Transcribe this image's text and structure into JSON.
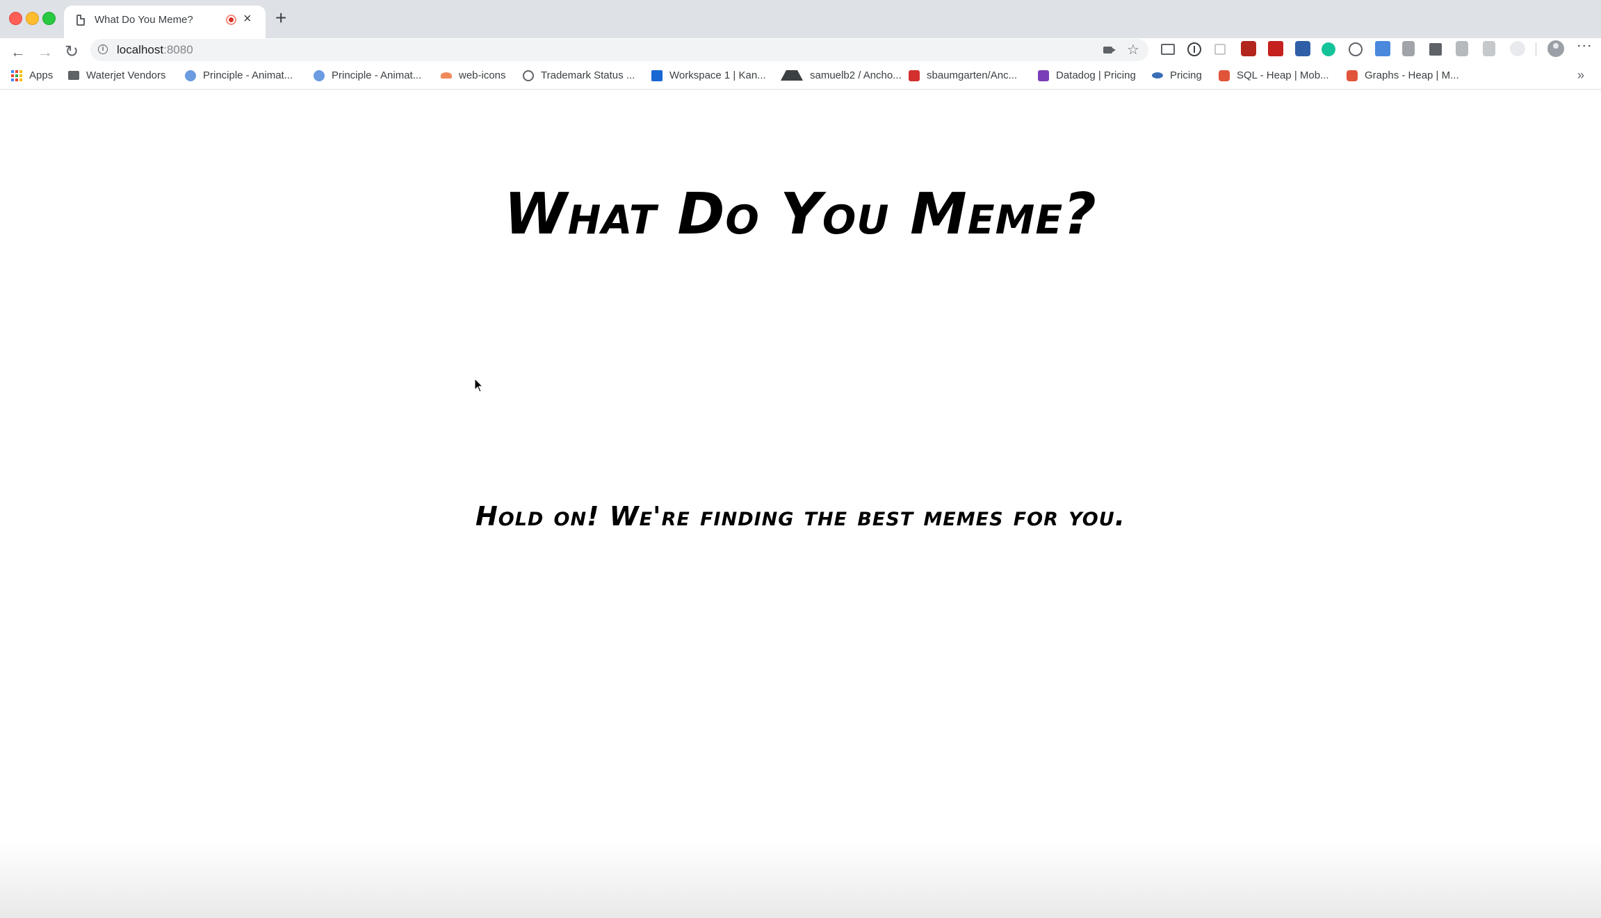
{
  "browser": {
    "tab": {
      "title": "What Do You Meme?"
    },
    "address": {
      "host": "localhost",
      "port": ":8080"
    }
  },
  "bookmarks": [
    {
      "label": "Apps",
      "icon": "apps-grid-icon"
    },
    {
      "label": "Waterjet Vendors",
      "icon": "folder-icon"
    },
    {
      "label": "Principle - Animat...",
      "icon": "globe-icon"
    },
    {
      "label": "Principle - Animat...",
      "icon": "globe-icon"
    },
    {
      "label": "web-icons",
      "icon": "sushi-icon"
    },
    {
      "label": "Trademark Status ...",
      "icon": "trademark-icon"
    },
    {
      "label": "Workspace 1 | Kan...",
      "icon": "workspace-icon"
    },
    {
      "label": "samuelb2 / Ancho...",
      "icon": "anchor-icon"
    },
    {
      "label": "sbaumgarten/Anc...",
      "icon": "oracle-icon"
    },
    {
      "label": "Datadog | Pricing",
      "icon": "datadog-icon"
    },
    {
      "label": "Pricing",
      "icon": "pricing-icon"
    },
    {
      "label": "SQL - Heap | Mob...",
      "icon": "heap-icon"
    },
    {
      "label": "Graphs - Heap | M...",
      "icon": "heap-icon"
    }
  ],
  "page": {
    "headline": "What Do You Meme?",
    "loading_message": "Hold on! We're finding the best memes for you."
  }
}
